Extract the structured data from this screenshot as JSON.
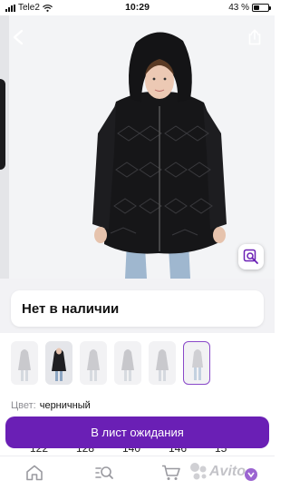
{
  "status_bar": {
    "carrier": "Tele2",
    "time": "10:29",
    "battery": "43 %",
    "battery_level": 0.43
  },
  "product": {
    "availability": "Нет в наличии",
    "color_label": "Цвет:",
    "color_value": "черничный",
    "thumbnail_count": 6,
    "selected_thumbnail_index": 5
  },
  "sizes": [
    "122",
    "128",
    "140",
    "146",
    "15"
  ],
  "cta": {
    "label": "В лист ожидания"
  },
  "icons": {
    "back": "chevron-left-icon",
    "share": "share-icon",
    "image_search": "image-search-icon",
    "home": "home-icon",
    "search": "search-icon",
    "cart": "cart-icon"
  },
  "colors": {
    "accent": "#6a1fb5",
    "selected_border": "#8a49c9",
    "muted_text": "#8d8d93"
  }
}
